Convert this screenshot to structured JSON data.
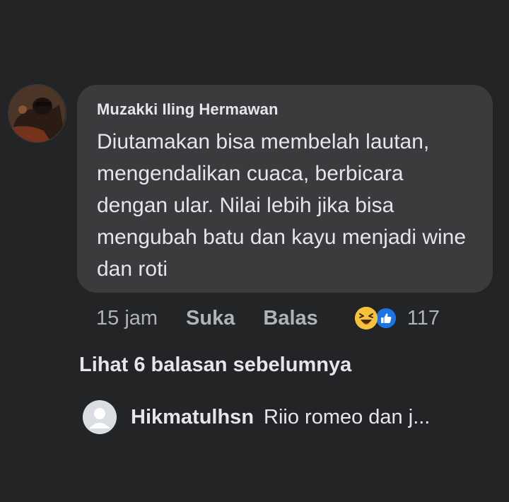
{
  "comment": {
    "author": "Muzakki Iling Hermawan",
    "text": "Diutamakan bisa membelah lautan, mengendalikan cuaca, berbicara dengan ular. Nilai lebih jika bisa mengubah batu dan kayu menjadi wine dan roti",
    "time": "15 jam",
    "like_label": "Suka",
    "reply_label": "Balas",
    "reactions": [
      "haha-icon",
      "like-icon"
    ],
    "reaction_count": "117"
  },
  "view_previous_replies": "Lihat 6 balasan sebelumnya",
  "reply": {
    "author": "Hikmatulhsn",
    "preview": "Riio romeo dan j..."
  },
  "colors": {
    "background": "#232425",
    "bubble": "#3a3b3c",
    "primary_text": "#e4e6eb",
    "secondary_text": "#b0b3b8",
    "haha": "#f7c23b",
    "like": "#1b74e4"
  }
}
